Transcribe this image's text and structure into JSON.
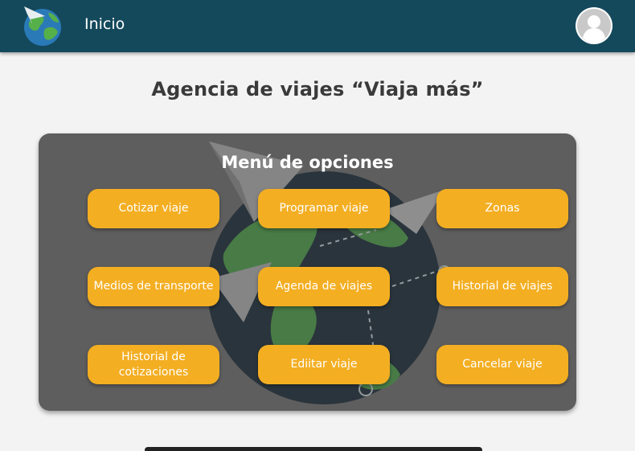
{
  "navbar": {
    "title": "Inicio",
    "logo_icon": "globe-plane-icon",
    "avatar_icon": "user-avatar-icon",
    "color": "#14495c"
  },
  "page": {
    "title": "Agencia de viajes  “Viaja más”"
  },
  "menu": {
    "heading": "Menú de opciones",
    "button_color": "#f3ae22",
    "options": [
      {
        "label": "Cotizar viaje"
      },
      {
        "label": "Programar viaje"
      },
      {
        "label": "Zonas"
      },
      {
        "label": "Medios de transporte"
      },
      {
        "label": "Agenda de viajes"
      },
      {
        "label": "Historial de viajes"
      },
      {
        "label": "Historial de cotizaciones"
      },
      {
        "label": "Ediitar viaje"
      },
      {
        "label": "Cancelar viaje"
      }
    ]
  }
}
